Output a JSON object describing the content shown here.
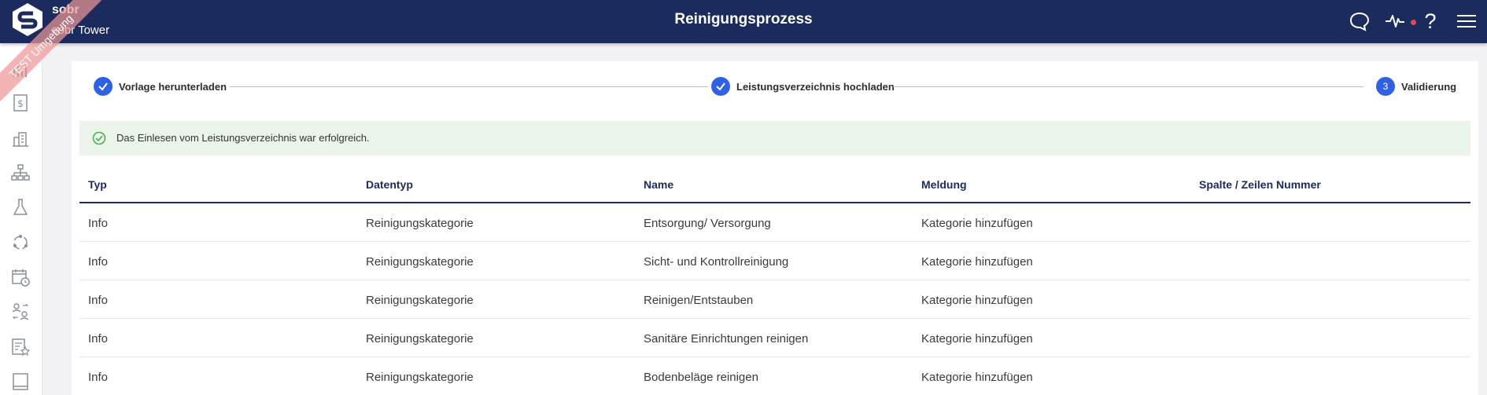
{
  "header": {
    "brand": "sobr",
    "tenant": "sobr Tower",
    "title": "Reinigungsprozess",
    "ribbon": "TEST Umgebung",
    "help": "?"
  },
  "sidebar": {
    "items": [
      {
        "icon": "dashboard-icon"
      },
      {
        "icon": "dollar-document-icon"
      },
      {
        "icon": "buildings-icon"
      },
      {
        "icon": "hierarchy-icon"
      },
      {
        "icon": "flask-icon"
      },
      {
        "icon": "cycle-icon"
      },
      {
        "icon": "calendar-clock-icon"
      },
      {
        "icon": "user-transfer-icon"
      },
      {
        "icon": "document-star-icon"
      },
      {
        "icon": "book-icon"
      }
    ]
  },
  "stepper": {
    "steps": [
      {
        "label": "Vorlage herunterladen",
        "state": "done"
      },
      {
        "label": "Leistungsverzeichnis hochladen",
        "state": "done"
      },
      {
        "label": "Validierung",
        "state": "active",
        "number": "3"
      }
    ]
  },
  "alert": {
    "text": "Das Einlesen vom Leistungsverzeichnis war erfolgreich."
  },
  "table": {
    "columns": [
      "Typ",
      "Datentyp",
      "Name",
      "Meldung",
      "Spalte / Zeilen Nummer"
    ],
    "rows": [
      [
        "Info",
        "Reinigungskategorie",
        "Entsorgung/ Versorgung",
        "Kategorie hinzufügen",
        ""
      ],
      [
        "Info",
        "Reinigungskategorie",
        "Sicht- und Kontrollreinigung",
        "Kategorie hinzufügen",
        ""
      ],
      [
        "Info",
        "Reinigungskategorie",
        "Reinigen/Entstauben",
        "Kategorie hinzufügen",
        ""
      ],
      [
        "Info",
        "Reinigungskategorie",
        "Sanitäre Einrichtungen reinigen",
        "Kategorie hinzufügen",
        ""
      ],
      [
        "Info",
        "Reinigungskategorie",
        "Bodenbeläge reinigen",
        "Kategorie hinzufügen",
        ""
      ]
    ]
  },
  "colors": {
    "header_bg": "#1b2b5e",
    "accent": "#2f62e3",
    "success_bg": "#eaf4ea",
    "success_icon": "#4caf50",
    "notification": "#e5484d"
  }
}
